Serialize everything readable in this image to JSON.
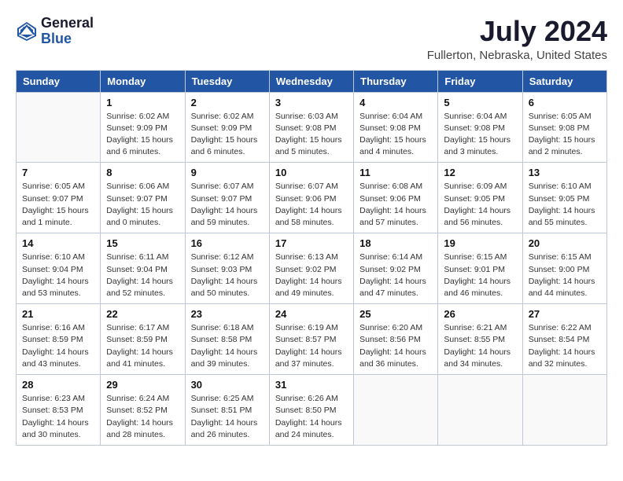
{
  "header": {
    "logo_line1": "General",
    "logo_line2": "Blue",
    "month": "July 2024",
    "location": "Fullerton, Nebraska, United States"
  },
  "weekdays": [
    "Sunday",
    "Monday",
    "Tuesday",
    "Wednesday",
    "Thursday",
    "Friday",
    "Saturday"
  ],
  "weeks": [
    [
      {
        "day": "",
        "info": ""
      },
      {
        "day": "1",
        "info": "Sunrise: 6:02 AM\nSunset: 9:09 PM\nDaylight: 15 hours\nand 6 minutes."
      },
      {
        "day": "2",
        "info": "Sunrise: 6:02 AM\nSunset: 9:09 PM\nDaylight: 15 hours\nand 6 minutes."
      },
      {
        "day": "3",
        "info": "Sunrise: 6:03 AM\nSunset: 9:08 PM\nDaylight: 15 hours\nand 5 minutes."
      },
      {
        "day": "4",
        "info": "Sunrise: 6:04 AM\nSunset: 9:08 PM\nDaylight: 15 hours\nand 4 minutes."
      },
      {
        "day": "5",
        "info": "Sunrise: 6:04 AM\nSunset: 9:08 PM\nDaylight: 15 hours\nand 3 minutes."
      },
      {
        "day": "6",
        "info": "Sunrise: 6:05 AM\nSunset: 9:08 PM\nDaylight: 15 hours\nand 2 minutes."
      }
    ],
    [
      {
        "day": "7",
        "info": "Sunrise: 6:05 AM\nSunset: 9:07 PM\nDaylight: 15 hours\nand 1 minute."
      },
      {
        "day": "8",
        "info": "Sunrise: 6:06 AM\nSunset: 9:07 PM\nDaylight: 15 hours\nand 0 minutes."
      },
      {
        "day": "9",
        "info": "Sunrise: 6:07 AM\nSunset: 9:07 PM\nDaylight: 14 hours\nand 59 minutes."
      },
      {
        "day": "10",
        "info": "Sunrise: 6:07 AM\nSunset: 9:06 PM\nDaylight: 14 hours\nand 58 minutes."
      },
      {
        "day": "11",
        "info": "Sunrise: 6:08 AM\nSunset: 9:06 PM\nDaylight: 14 hours\nand 57 minutes."
      },
      {
        "day": "12",
        "info": "Sunrise: 6:09 AM\nSunset: 9:05 PM\nDaylight: 14 hours\nand 56 minutes."
      },
      {
        "day": "13",
        "info": "Sunrise: 6:10 AM\nSunset: 9:05 PM\nDaylight: 14 hours\nand 55 minutes."
      }
    ],
    [
      {
        "day": "14",
        "info": "Sunrise: 6:10 AM\nSunset: 9:04 PM\nDaylight: 14 hours\nand 53 minutes."
      },
      {
        "day": "15",
        "info": "Sunrise: 6:11 AM\nSunset: 9:04 PM\nDaylight: 14 hours\nand 52 minutes."
      },
      {
        "day": "16",
        "info": "Sunrise: 6:12 AM\nSunset: 9:03 PM\nDaylight: 14 hours\nand 50 minutes."
      },
      {
        "day": "17",
        "info": "Sunrise: 6:13 AM\nSunset: 9:02 PM\nDaylight: 14 hours\nand 49 minutes."
      },
      {
        "day": "18",
        "info": "Sunrise: 6:14 AM\nSunset: 9:02 PM\nDaylight: 14 hours\nand 47 minutes."
      },
      {
        "day": "19",
        "info": "Sunrise: 6:15 AM\nSunset: 9:01 PM\nDaylight: 14 hours\nand 46 minutes."
      },
      {
        "day": "20",
        "info": "Sunrise: 6:15 AM\nSunset: 9:00 PM\nDaylight: 14 hours\nand 44 minutes."
      }
    ],
    [
      {
        "day": "21",
        "info": "Sunrise: 6:16 AM\nSunset: 8:59 PM\nDaylight: 14 hours\nand 43 minutes."
      },
      {
        "day": "22",
        "info": "Sunrise: 6:17 AM\nSunset: 8:59 PM\nDaylight: 14 hours\nand 41 minutes."
      },
      {
        "day": "23",
        "info": "Sunrise: 6:18 AM\nSunset: 8:58 PM\nDaylight: 14 hours\nand 39 minutes."
      },
      {
        "day": "24",
        "info": "Sunrise: 6:19 AM\nSunset: 8:57 PM\nDaylight: 14 hours\nand 37 minutes."
      },
      {
        "day": "25",
        "info": "Sunrise: 6:20 AM\nSunset: 8:56 PM\nDaylight: 14 hours\nand 36 minutes."
      },
      {
        "day": "26",
        "info": "Sunrise: 6:21 AM\nSunset: 8:55 PM\nDaylight: 14 hours\nand 34 minutes."
      },
      {
        "day": "27",
        "info": "Sunrise: 6:22 AM\nSunset: 8:54 PM\nDaylight: 14 hours\nand 32 minutes."
      }
    ],
    [
      {
        "day": "28",
        "info": "Sunrise: 6:23 AM\nSunset: 8:53 PM\nDaylight: 14 hours\nand 30 minutes."
      },
      {
        "day": "29",
        "info": "Sunrise: 6:24 AM\nSunset: 8:52 PM\nDaylight: 14 hours\nand 28 minutes."
      },
      {
        "day": "30",
        "info": "Sunrise: 6:25 AM\nSunset: 8:51 PM\nDaylight: 14 hours\nand 26 minutes."
      },
      {
        "day": "31",
        "info": "Sunrise: 6:26 AM\nSunset: 8:50 PM\nDaylight: 14 hours\nand 24 minutes."
      },
      {
        "day": "",
        "info": ""
      },
      {
        "day": "",
        "info": ""
      },
      {
        "day": "",
        "info": ""
      }
    ]
  ]
}
